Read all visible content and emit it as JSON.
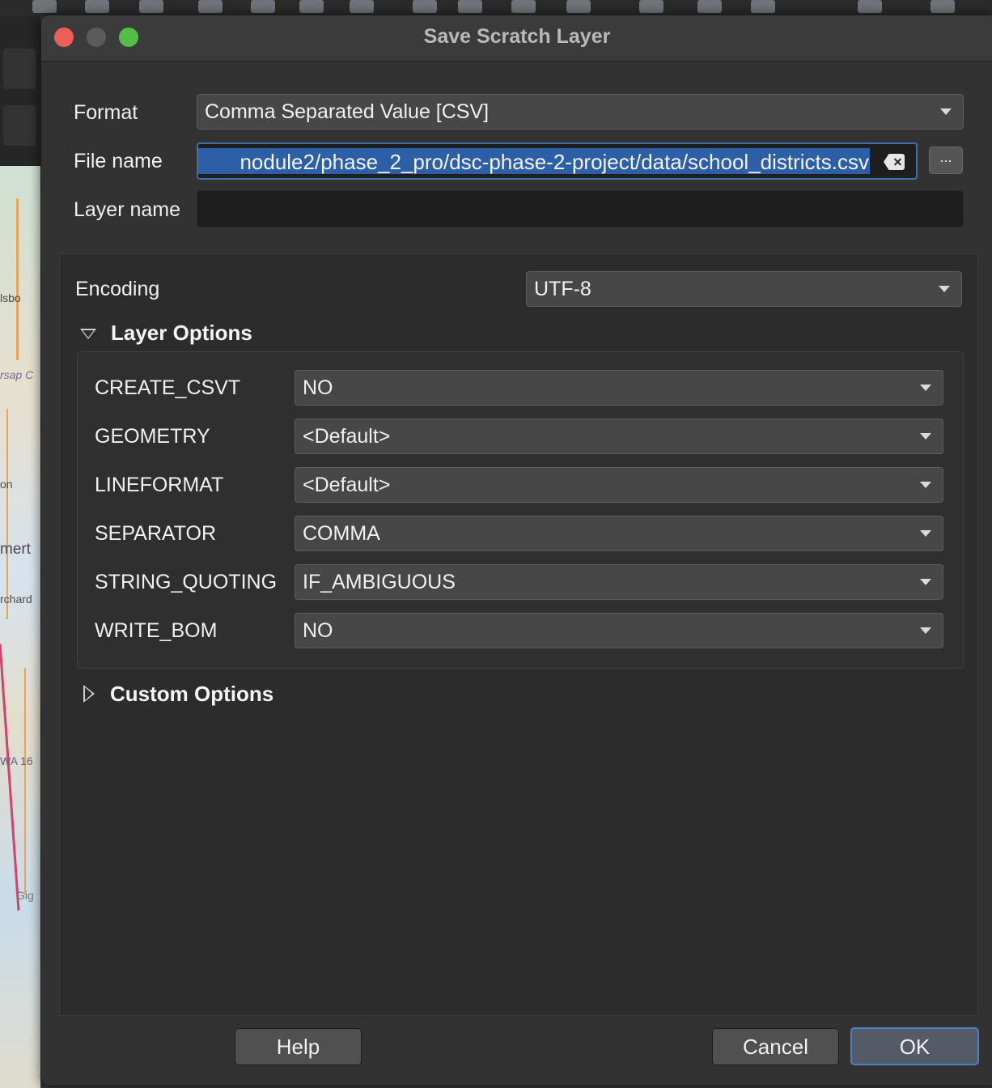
{
  "dialog": {
    "title": "Save Scratch Layer"
  },
  "form": {
    "format_label": "Format",
    "format_value": "Comma Separated Value [CSV]",
    "filename_label": "File name",
    "filename_value": "nodule2/phase_2_pro/dsc-phase-2-project/data/school_districts.csv",
    "browse_label": "...",
    "layername_label": "Layer name",
    "layername_value": "",
    "encoding_label": "Encoding",
    "encoding_value": "UTF-8"
  },
  "layer_options": {
    "header": "Layer Options",
    "items": [
      {
        "label": "CREATE_CSVT",
        "value": "NO"
      },
      {
        "label": "GEOMETRY",
        "value": "<Default>"
      },
      {
        "label": "LINEFORMAT",
        "value": "<Default>"
      },
      {
        "label": "SEPARATOR",
        "value": "COMMA"
      },
      {
        "label": "STRING_QUOTING",
        "value": "IF_AMBIGUOUS"
      },
      {
        "label": "WRITE_BOM",
        "value": "NO"
      }
    ]
  },
  "custom_options": {
    "header": "Custom Options"
  },
  "buttons": {
    "help": "Help",
    "cancel": "Cancel",
    "ok": "OK"
  },
  "background_map": {
    "labels": [
      "lsbo",
      "rsap C",
      "on",
      "mert",
      "rchard",
      "WA 16",
      "Gig"
    ]
  },
  "colors": {
    "close": "#ec5f57",
    "minimize": "#5b5b5b",
    "maximize": "#55bc47",
    "selection": "#2d5fa6",
    "focus_ring": "#4a7fc4"
  }
}
